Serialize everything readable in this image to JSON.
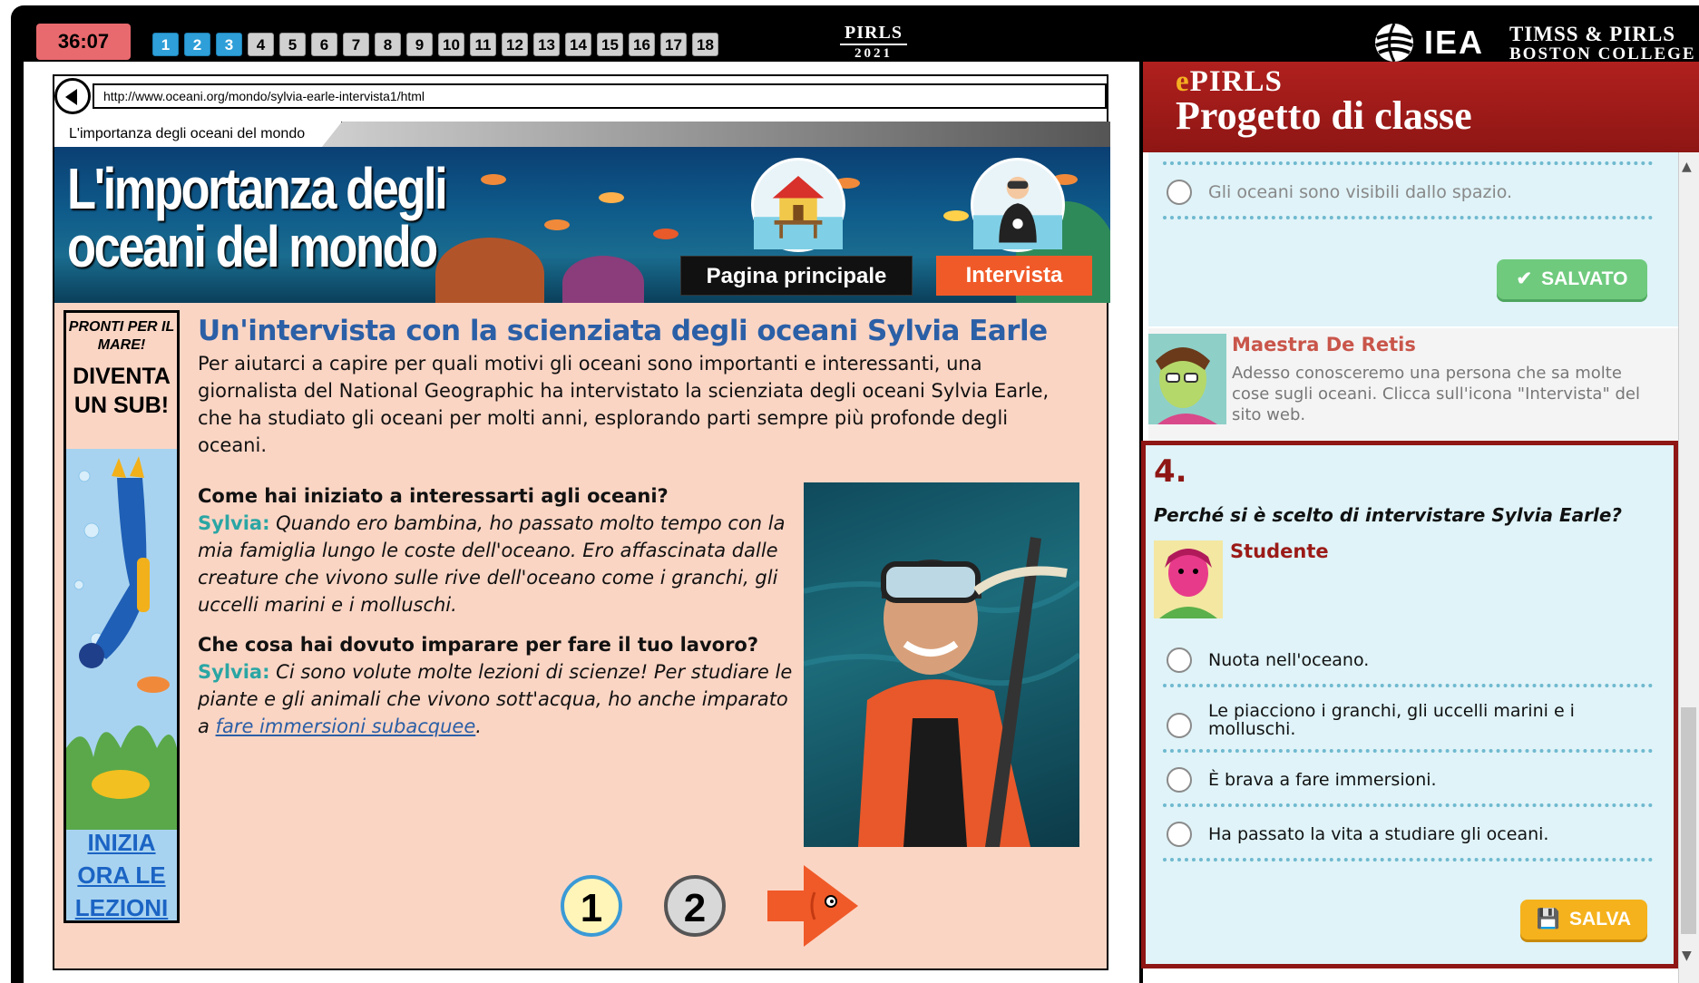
{
  "topbar": {
    "timer": "36:07",
    "questions": [
      {
        "label": "1",
        "done": true
      },
      {
        "label": "2",
        "done": true
      },
      {
        "label": "3",
        "done": true
      },
      {
        "label": "4",
        "done": false
      },
      {
        "label": "5",
        "done": false
      },
      {
        "label": "6",
        "done": false
      },
      {
        "label": "7",
        "done": false
      },
      {
        "label": "8",
        "done": false
      },
      {
        "label": "9",
        "done": false
      },
      {
        "label": "10",
        "done": false
      },
      {
        "label": "11",
        "done": false
      },
      {
        "label": "12",
        "done": false
      },
      {
        "label": "13",
        "done": false
      },
      {
        "label": "14",
        "done": false
      },
      {
        "label": "15",
        "done": false
      },
      {
        "label": "16",
        "done": false
      },
      {
        "label": "17",
        "done": false
      },
      {
        "label": "18",
        "done": false
      }
    ],
    "pirls_title": "PIRLS",
    "pirls_year": "2021",
    "iea": "IEA",
    "timss_line1": "TIMSS & PIRLS",
    "timss_line2": "BOSTON COLLEGE"
  },
  "browser": {
    "url": "http://www.oceani.org/mondo/sylvia-earle-intervista1/html",
    "tab_label": "L'importanza degli oceani del mondo"
  },
  "banner": {
    "title_line1": "L'importanza degli",
    "title_line2": "oceani del mondo",
    "home_button": "Pagina principale",
    "interview_button": "Intervista"
  },
  "ad": {
    "line1": "PRONTI PER IL MARE!",
    "line2": "DIVENTA UN SUB!",
    "link": "INIZIA ORA LE LEZIONI"
  },
  "article": {
    "title": "Un'intervista con la scienziata degli oceani Sylvia Earle",
    "intro": "Per aiutarci a capire per quali motivi gli oceani sono importanti e interessanti, una giornalista del National Geographic ha intervistato la scienziata degli oceani Sylvia Earle, che ha studiato gli oceani per molti anni, esplorando parti sempre più profonde degli oceani.",
    "q1": "Come hai iniziato a interessarti agli oceani?",
    "speaker": "Sylvia:",
    "a1": "Quando ero bambina, ho passato molto tempo con la mia famiglia lungo le coste dell'oceano. Ero affascinata dalle creature che vivono sulle rive dell'oceano come i granchi, gli uccelli marini e i molluschi.",
    "q2": "Che cosa hai dovuto imparare per fare il tuo lavoro?",
    "a2_before": "Ci sono volute molte lezioni di scienze! Per studiare le piante e gli animali che vivono sott'acqua, ho anche imparato a ",
    "a2_link": "fare immersioni subacquee",
    "a2_after": "."
  },
  "pager": {
    "page1": "1",
    "page2": "2"
  },
  "panel": {
    "epirls_e": "e",
    "epirls_rest": "PIRLS",
    "title": "Progetto di classe",
    "prev_option": "Gli oceani sono visibili dallo spazio.",
    "saved_button": "SALVATO",
    "teacher_name": "Maestra De Retis",
    "teacher_msg": "Adesso conosceremo una persona che sa molte cose sugli oceani. Clicca sull'icona \"Intervista\" del sito web.",
    "q_number": "4.",
    "q_text": "Perché si è scelto di intervistare Sylvia Earle?",
    "student_label": "Studente",
    "options": [
      "Nuota nell'oceano.",
      "Le piacciono i granchi, gli uccelli marini e i molluschi.",
      "È brava a fare immersioni.",
      "Ha passato la vita a studiare gli oceani."
    ],
    "save_button": "SALVA"
  }
}
